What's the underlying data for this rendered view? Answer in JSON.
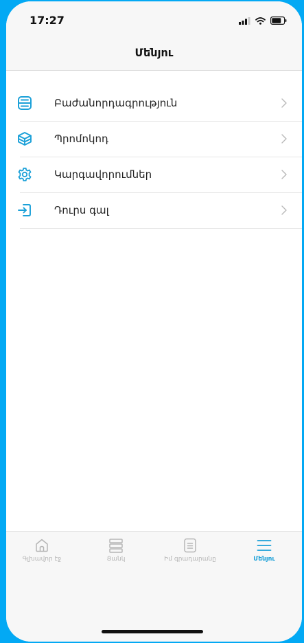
{
  "status_bar": {
    "time": "17:27"
  },
  "header": {
    "title": "Մենյու"
  },
  "menu": {
    "items": [
      {
        "label": "Բաժանորդագրություն",
        "icon": "server-icon"
      },
      {
        "label": "Պրոմոկոդ",
        "icon": "box-icon"
      },
      {
        "label": "Կարգավորումներ",
        "icon": "gear-icon"
      },
      {
        "label": "Դուրս գալ",
        "icon": "logout-icon"
      }
    ]
  },
  "tabbar": {
    "tabs": [
      {
        "label": "Գլխավոր էջ",
        "icon": "home-icon",
        "active": false
      },
      {
        "label": "Ցանկ",
        "icon": "list-icon",
        "active": false
      },
      {
        "label": "Իմ գրադարանը",
        "icon": "library-icon",
        "active": false
      },
      {
        "label": "Մենյու",
        "icon": "menu-icon",
        "active": true
      }
    ]
  },
  "colors": {
    "accent": "#1aa0d8",
    "background": "#03a9f4",
    "inactive": "#b5b5b5"
  }
}
